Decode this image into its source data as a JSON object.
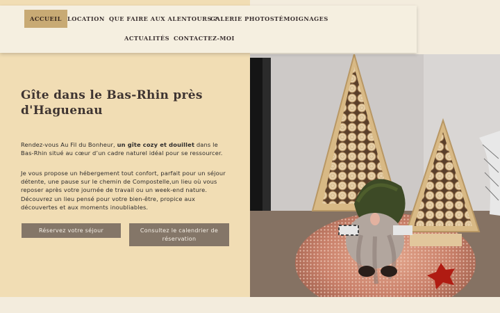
{
  "nav": {
    "items": [
      {
        "label": "ACCUEIL",
        "active": true
      },
      {
        "label": "LOCATION"
      },
      {
        "label": "QUE FAIRE AUX ALENTOURS ?"
      },
      {
        "label": "GALERIE PHOTOS"
      },
      {
        "label": "TÉMOIGNAGES"
      },
      {
        "label": "ACTUALITÉS"
      },
      {
        "label": "CONTACTEZ-MOI"
      }
    ]
  },
  "hero": {
    "title": "Gîte dans le Bas-Rhin près d'Haguenau",
    "intro_before": "Rendez-vous Au Fil du Bonheur, ",
    "intro_bold": "un gîte cozy et douillet",
    "intro_after": " dans le Bas-Rhin situé au cœur d’un cadre naturel idéal pour se ressourcer.",
    "paragraph2": "Je vous propose un hébergement tout confort, parfait pour un séjour détente, une pause sur le chemin de Compostelle,un lieu où vous reposer après votre journée de travail ou un week-end nature. Découvrez un lieu pensé pour votre bien-être, propice aux découvertes et aux moments inoubliables.",
    "btn_reserve": "Réservez votre séjour",
    "btn_calendar": "Consultez le calendrier de réservation"
  },
  "colors": {
    "hero_bg": "#f1ddb4",
    "nav_bg": "#f5efe0",
    "nav_active": "#c8aa74",
    "button": "#847668"
  }
}
